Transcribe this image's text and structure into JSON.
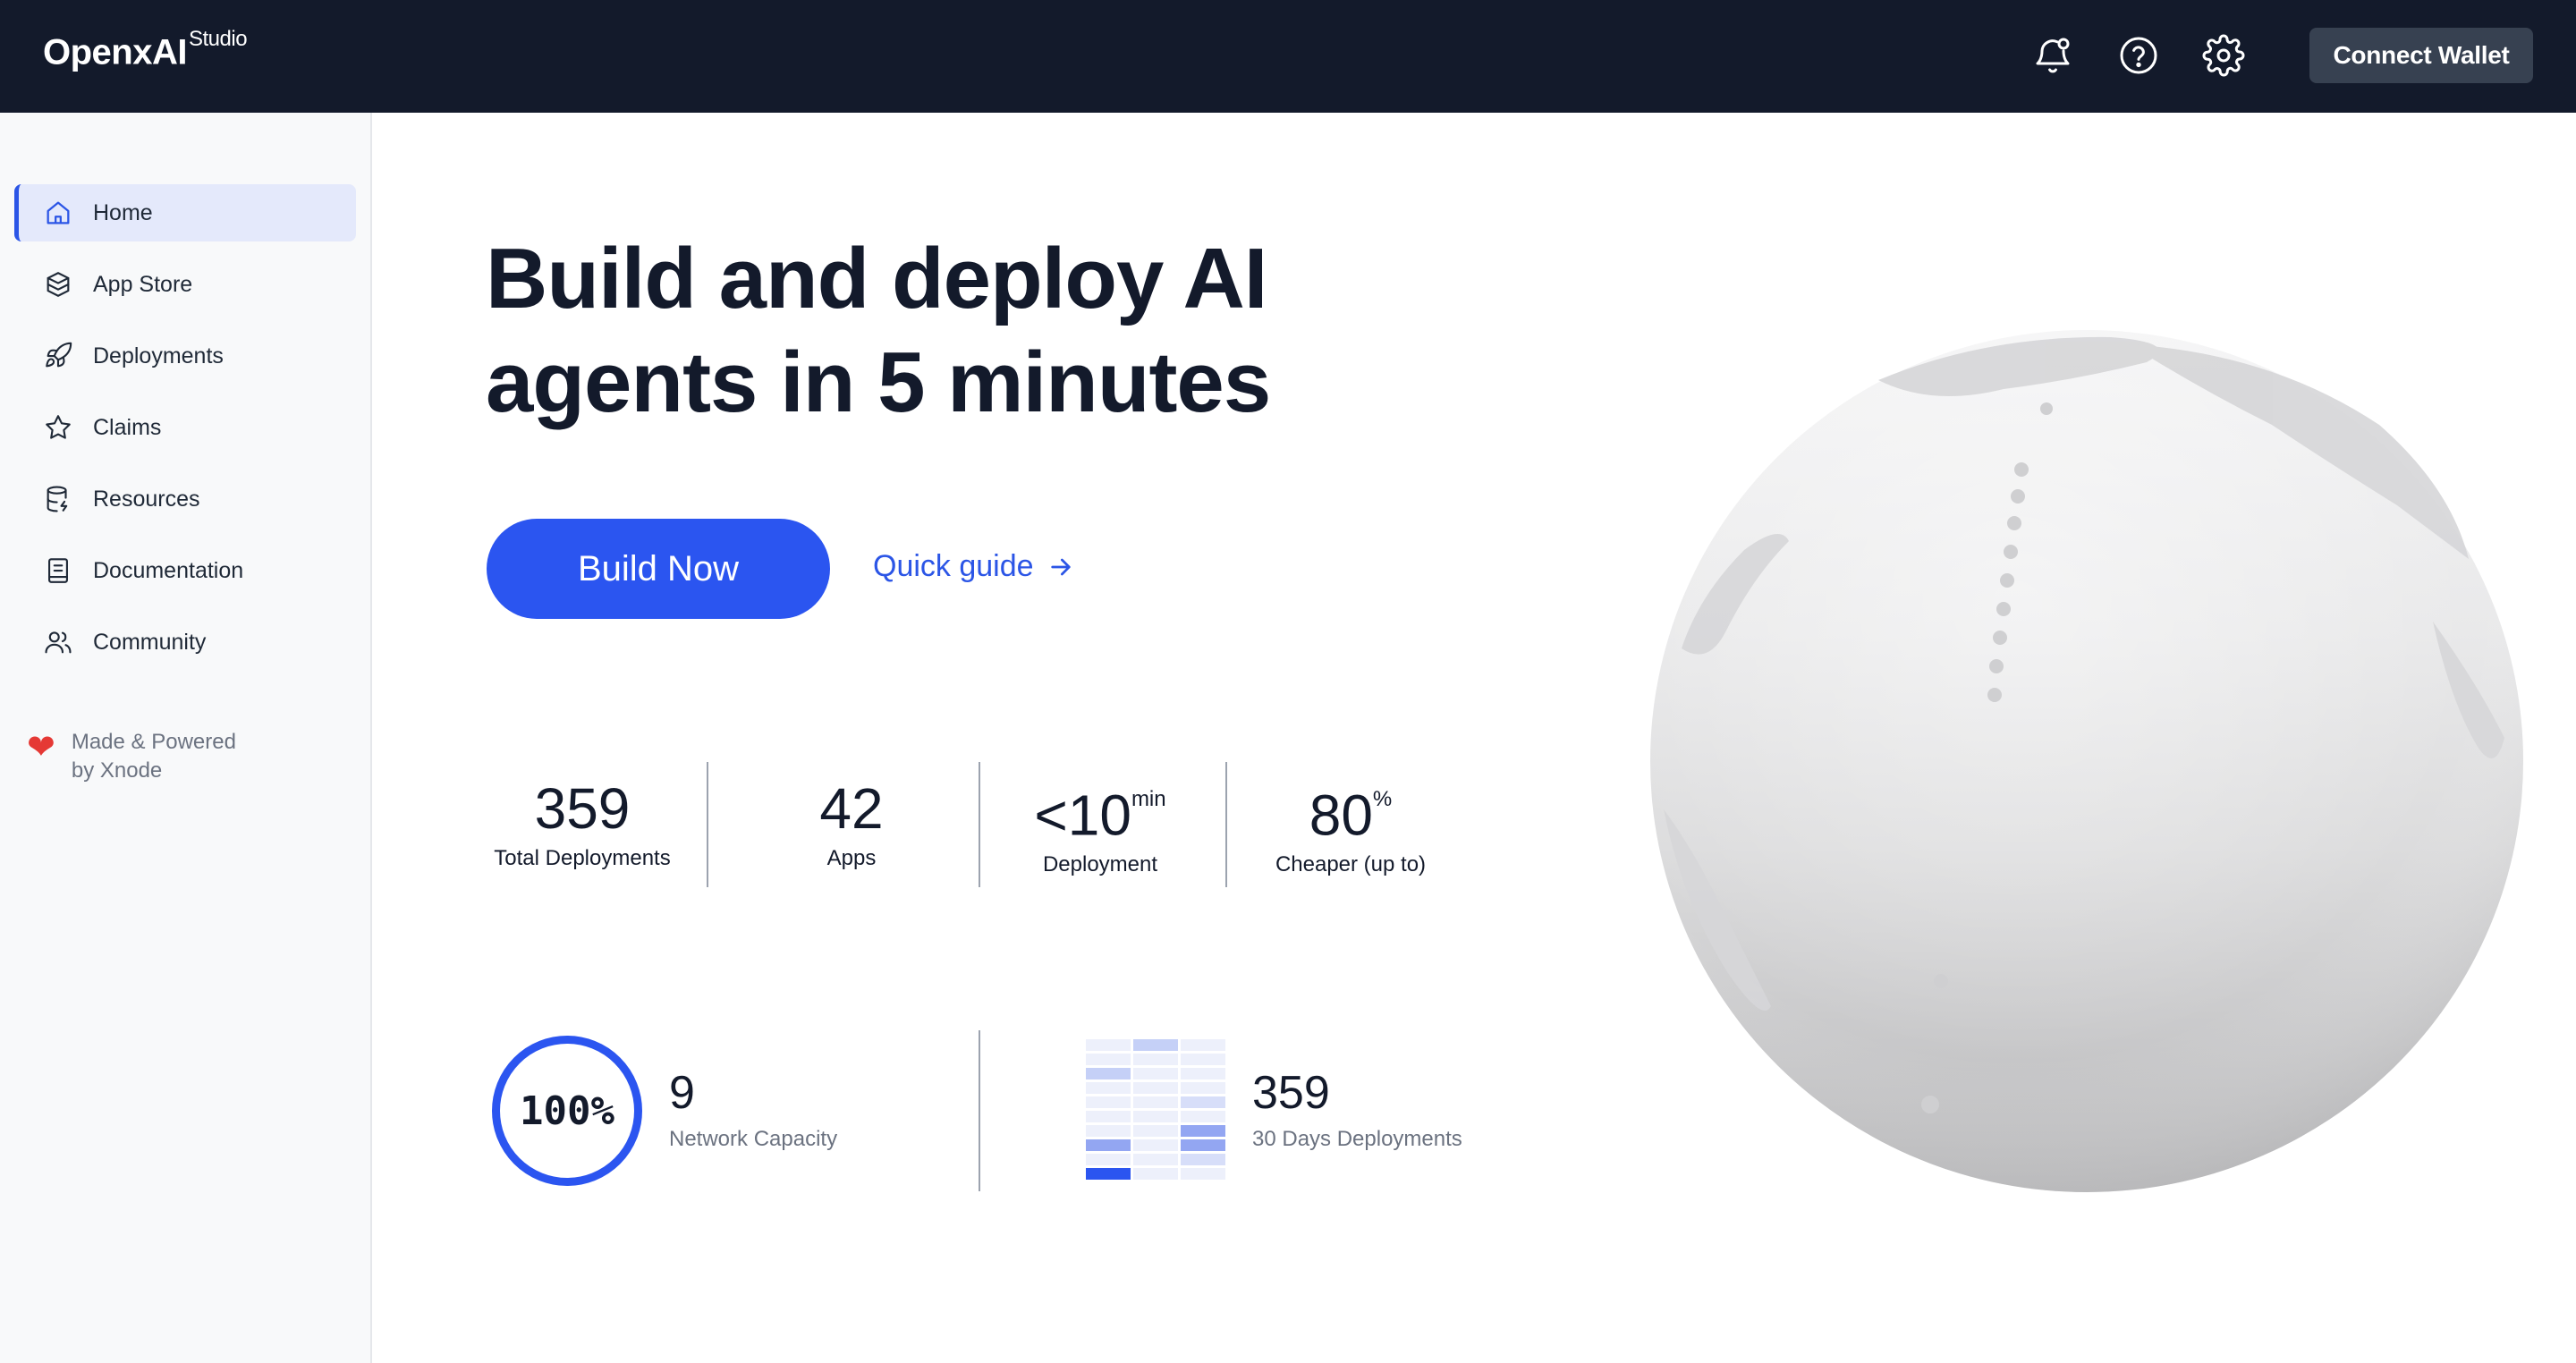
{
  "header": {
    "logo": "OpenxAI",
    "logo_super": "Studio",
    "icons": [
      "bell-icon",
      "help-icon",
      "gear-icon"
    ],
    "connect_label": "Connect Wallet"
  },
  "sidebar": {
    "items": [
      {
        "label": "Home",
        "icon": "home-icon",
        "active": true
      },
      {
        "label": "App Store",
        "icon": "box-icon"
      },
      {
        "label": "Deployments",
        "icon": "rocket-icon"
      },
      {
        "label": "Claims",
        "icon": "star-icon"
      },
      {
        "label": "Resources",
        "icon": "database-icon"
      },
      {
        "label": "Documentation",
        "icon": "document-icon"
      },
      {
        "label": "Community",
        "icon": "users-icon"
      }
    ],
    "powered_line1": "Made & Powered",
    "powered_line2": "by Xnode"
  },
  "hero": {
    "title_line1": "Build and deploy AI",
    "title_line2": "agents in 5 minutes",
    "primary_cta": "Build Now",
    "secondary_cta": "Quick guide"
  },
  "stats": [
    {
      "value": "359",
      "sup": "",
      "label": "Total Deployments"
    },
    {
      "value": "42",
      "sup": "",
      "label": "Apps"
    },
    {
      "value": "<10",
      "sup": "min",
      "label": "Deployment"
    },
    {
      "value": "80",
      "sup": "%",
      "label": "Cheaper (up to)"
    }
  ],
  "capacity": {
    "percent_text": "100%",
    "value": "9",
    "label": "Network Capacity"
  },
  "deployments30": {
    "value": "359",
    "label": "30 Days Deployments"
  },
  "colors": {
    "topbar": "#131a2b",
    "accent": "#2b55f0",
    "sidebar_bg": "#f8f9fa",
    "active_bg": "#e4e9fb"
  }
}
